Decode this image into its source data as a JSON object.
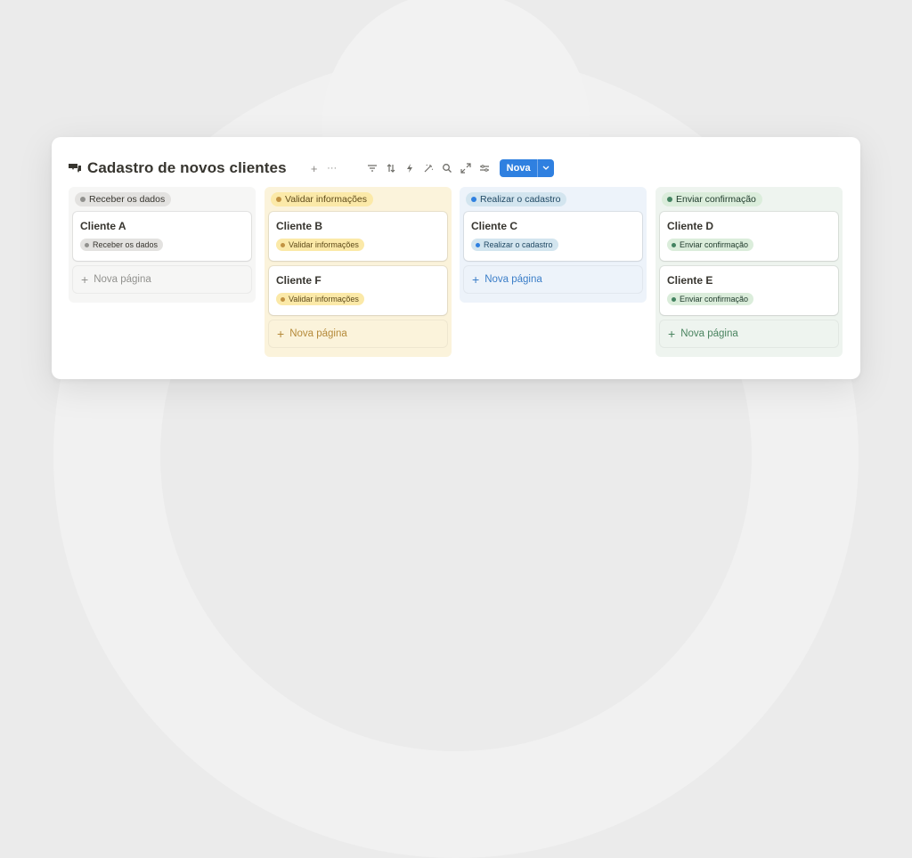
{
  "board": {
    "title": "Cadastro de novos clientes",
    "header_add": "+",
    "header_more": "···",
    "new_button_label": "Nova",
    "accent_color": "#2f80e0"
  },
  "toolbar": {
    "icons": [
      "filter-icon",
      "sort-icon",
      "automation-icon",
      "ai-icon",
      "search-icon",
      "expand-icon",
      "settings-icon"
    ]
  },
  "columns": [
    {
      "label": "Receber os dados",
      "colors": {
        "bg": "#f6f6f5",
        "pill_bg": "#e3e2e0",
        "pill_text": "#37352f",
        "dot": "#91918e",
        "add_text": "#91918e"
      },
      "cards": [
        {
          "name": "Cliente A",
          "tag": "Receber os dados"
        }
      ],
      "add_label": "Nova página"
    },
    {
      "label": "Validar informações",
      "colors": {
        "bg": "#fbf3db",
        "pill_bg": "#fbe9a8",
        "pill_text": "#5f4b1a",
        "dot": "#c29343",
        "add_text": "#b58a3a"
      },
      "cards": [
        {
          "name": "Cliente B",
          "tag": "Validar informações"
        },
        {
          "name": "Cliente F",
          "tag": "Validar informações"
        }
      ],
      "add_label": "Nova página"
    },
    {
      "label": "Realizar o cadastro",
      "colors": {
        "bg": "#edf3fa",
        "pill_bg": "#d3e5ef",
        "pill_text": "#1f4863",
        "dot": "#2f80e0",
        "add_text": "#3b7ec8"
      },
      "cards": [
        {
          "name": "Cliente C",
          "tag": "Realizar o cadastro"
        }
      ],
      "add_label": "Nova página"
    },
    {
      "label": "Enviar confirmação",
      "colors": {
        "bg": "#eef4ef",
        "pill_bg": "#dbeddb",
        "pill_text": "#1c3829",
        "dot": "#448361",
        "add_text": "#4a8460"
      },
      "cards": [
        {
          "name": "Cliente D",
          "tag": "Enviar confirmação"
        },
        {
          "name": "Cliente E",
          "tag": "Enviar confirmação"
        }
      ],
      "add_label": "Nova página"
    }
  ]
}
